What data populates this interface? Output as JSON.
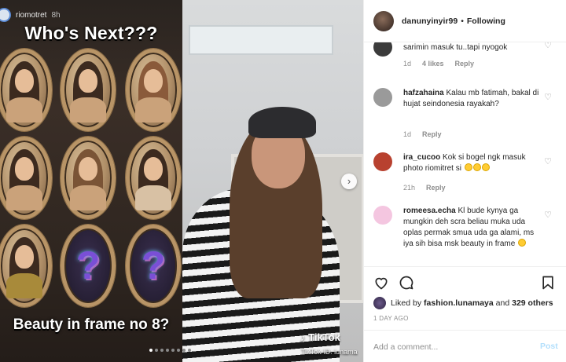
{
  "story": {
    "user": "riomotret",
    "time": "8h",
    "title": "Who's Next???",
    "caption": "Beauty in frame no 8?",
    "question_mark": "?",
    "slide_count": 8,
    "active_slide": 1
  },
  "video": {
    "watermark": "TikTok",
    "watermark_id": "TikTok ID: lunama"
  },
  "header": {
    "username": "danunyinyir99",
    "separator": "•",
    "follow_status": "Following"
  },
  "comments": [
    {
      "username": "",
      "text": "sarimin masuk tu..tapi nyogok",
      "age": "1d",
      "likes": "4 likes",
      "reply": "Reply",
      "avatar_color": "#3b3b3b"
    },
    {
      "username": "hafzahaina",
      "text": "Kalau mb fatimah, bakal di hujat seindonesia rayakah?",
      "age": "1d",
      "likes": "",
      "reply": "Reply",
      "avatar_color": "#9a9a9a"
    },
    {
      "username": "ira_cucoo",
      "text": "Kok si bogel ngk masuk photo riomitret si",
      "age": "21h",
      "likes": "",
      "reply": "Reply",
      "avatar_color": "#b8412f"
    },
    {
      "username": "romeesa.echa",
      "text": "Kl bude kynya ga mungkin deh scra beliau muka uda oplas permak smua uda ga alami, ms iya sih bisa msk beauty in frame",
      "age": "",
      "likes": "",
      "reply": "",
      "avatar_color": "#f4c6e0"
    }
  ],
  "likes": {
    "prefix": "Liked by",
    "user": "fashion.lunamaya",
    "joiner": "and",
    "count": "329 others"
  },
  "date": "1 DAY AGO",
  "add_comment": {
    "placeholder": "Add a comment...",
    "post_label": "Post"
  },
  "colors": {
    "link_blue": "#b2dffc",
    "muted": "#8e8e8e",
    "text": "#262626"
  }
}
